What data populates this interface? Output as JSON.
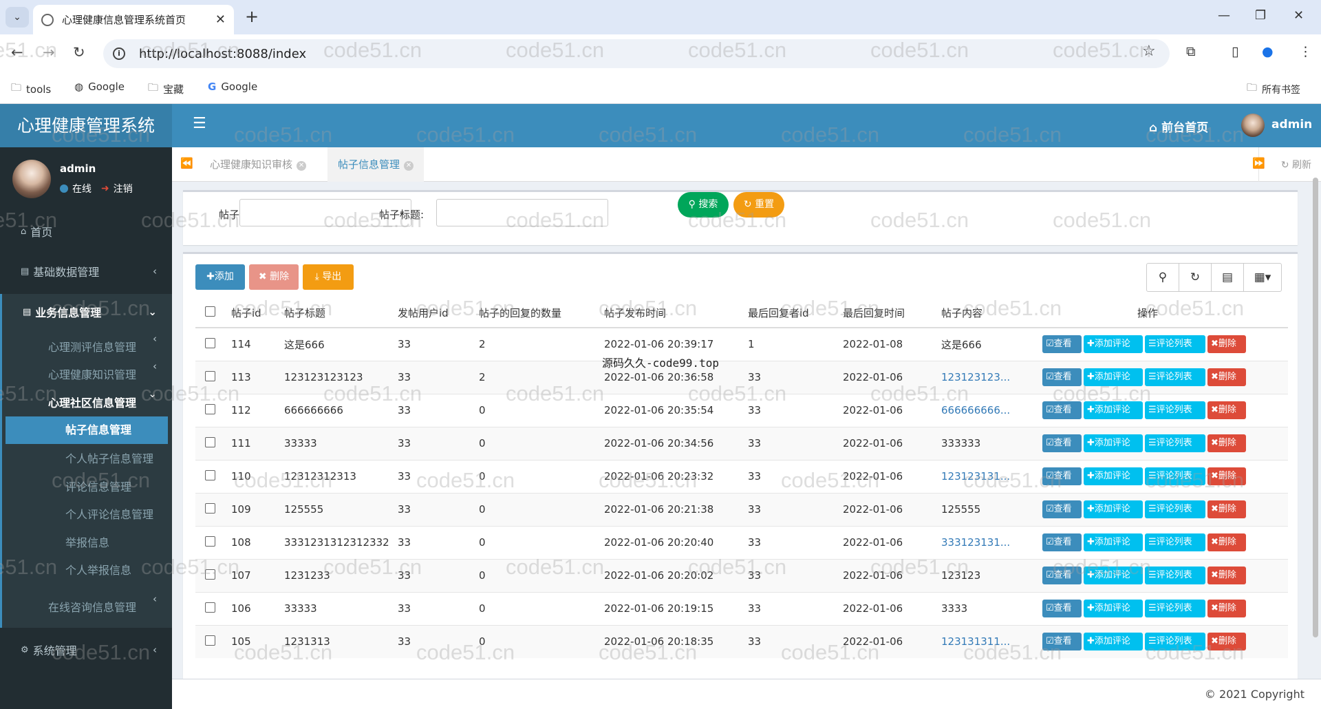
{
  "browser": {
    "tab_title": "心理健康信息管理系统首页",
    "url": "http://localhost:8088/index",
    "bookmarks": [
      "tools",
      "Google",
      "宝藏",
      "Google"
    ],
    "all_bookmarks": "所有书签"
  },
  "header": {
    "logo": "心理健康管理系统",
    "home_link": "前台首页",
    "user": "admin"
  },
  "sidebar": {
    "user": "admin",
    "online": "在线",
    "logout": "注销",
    "menu": {
      "home": "首页",
      "basic_data": "基础数据管理",
      "business": "业务信息管理",
      "assessment": "心理测评信息管理",
      "knowledge": "心理健康知识管理",
      "community": "心理社区信息管理",
      "posts": "帖子信息管理",
      "my_posts": "个人帖子信息管理",
      "comments": "评论信息管理",
      "my_comments": "个人评论信息管理",
      "reports": "举报信息",
      "my_reports": "个人举报信息",
      "consult": "在线咨询信息管理",
      "system": "系统管理"
    }
  },
  "page_tabs": [
    "心理健康知识审核",
    "帖子信息管理"
  ],
  "refresh": "刷新",
  "search": {
    "post_label": "帖子:",
    "title_label": "帖子标题:",
    "search_btn": "搜索",
    "reset_btn": "重置"
  },
  "toolbar": {
    "add": "添加",
    "delete": "删除",
    "export": "导出"
  },
  "table": {
    "columns": [
      "帖子id",
      "帖子标题",
      "发帖用户id",
      "帖子的回复的数量",
      "帖子发布时间",
      "最后回复者id",
      "最后回复时间",
      "帖子内容",
      "操作"
    ],
    "actions": {
      "view": "查看",
      "add_comment": "添加评论",
      "comment_list": "评论列表",
      "delete": "删除"
    },
    "rows": [
      {
        "id": "114",
        "title": "这是666",
        "uid": "33",
        "count": "2",
        "time": "2022-01-06 20:39:17",
        "last_id": "1",
        "last_time": "2022-01-08",
        "content": "这是666",
        "link": false
      },
      {
        "id": "113",
        "title": "123123123123",
        "uid": "33",
        "count": "2",
        "time": "2022-01-06 20:36:58",
        "last_id": "33",
        "last_time": "2022-01-06",
        "content": "123123123...",
        "link": true
      },
      {
        "id": "112",
        "title": "666666666",
        "uid": "33",
        "count": "0",
        "time": "2022-01-06 20:35:54",
        "last_id": "33",
        "last_time": "2022-01-06",
        "content": "666666666...",
        "link": true
      },
      {
        "id": "111",
        "title": "33333",
        "uid": "33",
        "count": "0",
        "time": "2022-01-06 20:34:56",
        "last_id": "33",
        "last_time": "2022-01-06",
        "content": "333333",
        "link": false
      },
      {
        "id": "110",
        "title": "12312312313",
        "uid": "33",
        "count": "0",
        "time": "2022-01-06 20:23:32",
        "last_id": "33",
        "last_time": "2022-01-06",
        "content": "123123131...",
        "link": true
      },
      {
        "id": "109",
        "title": "125555",
        "uid": "33",
        "count": "0",
        "time": "2022-01-06 20:21:38",
        "last_id": "33",
        "last_time": "2022-01-06",
        "content": "125555",
        "link": false
      },
      {
        "id": "108",
        "title": "3331231312312332",
        "uid": "33",
        "count": "0",
        "time": "2022-01-06 20:20:40",
        "last_id": "33",
        "last_time": "2022-01-06",
        "content": "333123131...",
        "link": true
      },
      {
        "id": "107",
        "title": "1231233",
        "uid": "33",
        "count": "0",
        "time": "2022-01-06 20:20:02",
        "last_id": "33",
        "last_time": "2022-01-06",
        "content": "123123",
        "link": false
      },
      {
        "id": "106",
        "title": "33333",
        "uid": "33",
        "count": "0",
        "time": "2022-01-06 20:19:15",
        "last_id": "33",
        "last_time": "2022-01-06",
        "content": "3333",
        "link": false
      },
      {
        "id": "105",
        "title": "1231313",
        "uid": "33",
        "count": "0",
        "time": "2022-01-06 20:18:35",
        "last_id": "33",
        "last_time": "2022-01-06",
        "content": "123131311...",
        "link": true
      }
    ]
  },
  "watermark_caption": "源码久久-code99.top",
  "watermark": "code51.cn",
  "footer": "© 2021 Copyright",
  "colors": {
    "primary": "#3c8dbc",
    "info": "#00c0ef",
    "danger": "#dd4b39",
    "success": "#00a65a",
    "warning": "#f39c12",
    "sidebar": "#222d32"
  }
}
